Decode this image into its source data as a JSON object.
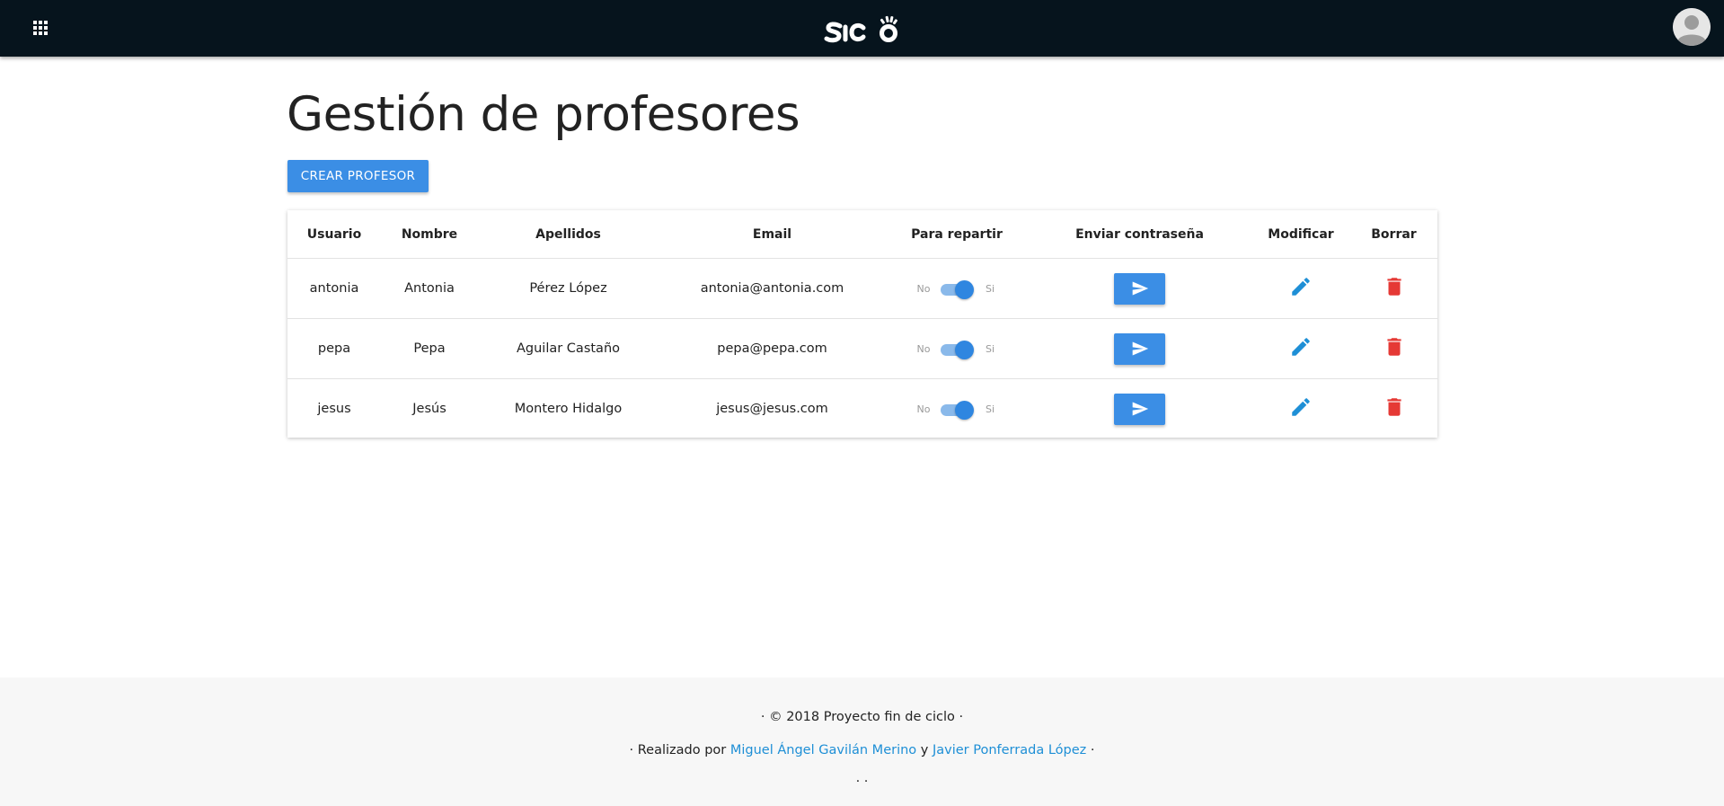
{
  "header": {
    "apps_icon": "apps-grid-icon",
    "logo_text": "SICO",
    "avatar_icon": "user-avatar-icon"
  },
  "main": {
    "title": "Gestión de profesores",
    "create_button": "CREAR PROFESOR",
    "table": {
      "columns": [
        "Usuario",
        "Nombre",
        "Apellidos",
        "Email",
        "Para repartir",
        "Enviar contraseña",
        "Modificar",
        "Borrar"
      ],
      "switch_labels": {
        "off": "No",
        "on": "Si"
      },
      "rows": [
        {
          "usuario": "antonia",
          "nombre": "Antonia",
          "apellidos": "Pérez López",
          "email": "antonia@antonia.com",
          "para_repartir": true
        },
        {
          "usuario": "pepa",
          "nombre": "Pepa",
          "apellidos": "Aguilar Castaño",
          "email": "pepa@pepa.com",
          "para_repartir": true
        },
        {
          "usuario": "jesus",
          "nombre": "Jesús",
          "apellidos": "Montero Hidalgo",
          "email": "jesus@jesus.com",
          "para_repartir": true
        }
      ],
      "icons": {
        "send": "send-icon",
        "edit": "pencil-icon",
        "delete": "trash-icon"
      }
    }
  },
  "footer": {
    "line1": "· © 2018 Proyecto fin de ciclo ·",
    "line2_prefix": "· Realizado por ",
    "author1": "Miguel Ángel Gavilán Merino",
    "line2_join": " y ",
    "author2": "Javier Ponferrada López",
    "line2_suffix": " ·",
    "line3": "· ·"
  },
  "colors": {
    "topbar": "#06141d",
    "primary": "#3b8ee5",
    "edit_icon": "#1e8fd6",
    "delete_icon": "#e53935",
    "link": "#1e8fd6",
    "footer_bg": "#f7f7f7"
  }
}
